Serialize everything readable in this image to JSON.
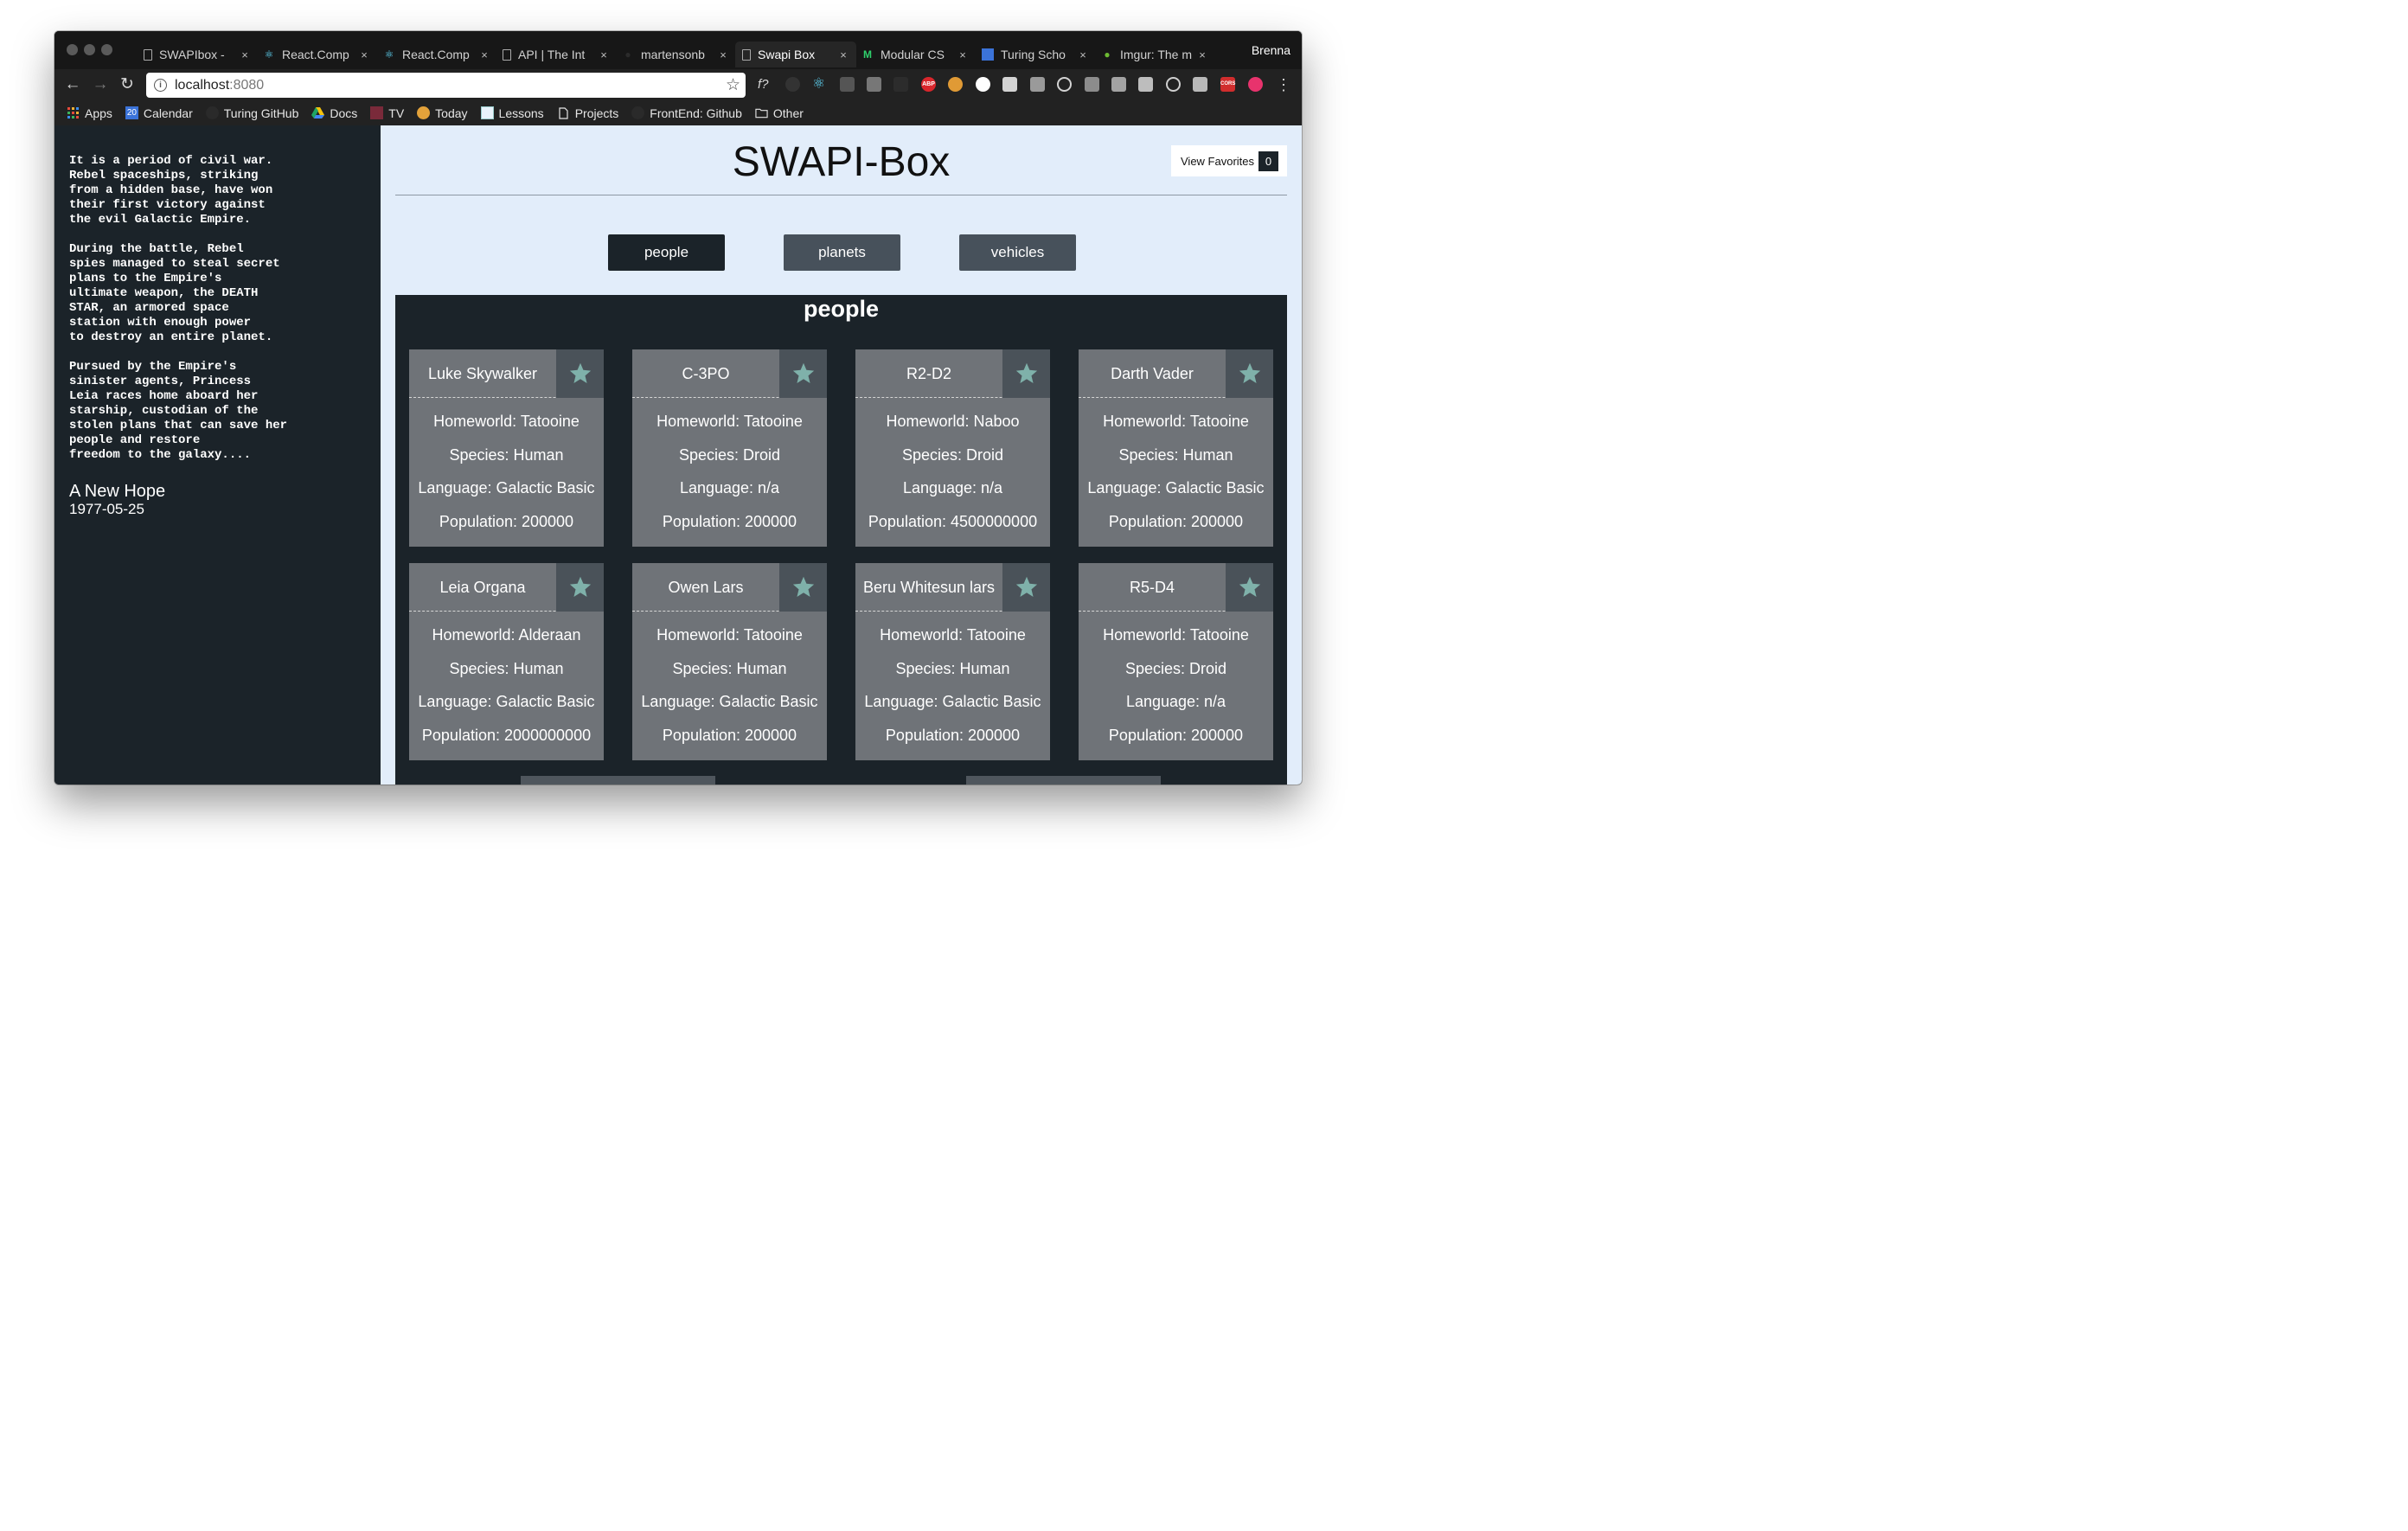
{
  "browser": {
    "tabs": [
      {
        "title": "SWAPIbox - ",
        "icon": "page-icon"
      },
      {
        "title": "React.Comp",
        "icon": "react-icon"
      },
      {
        "title": "React.Comp",
        "icon": "react-icon"
      },
      {
        "title": "API | The Int",
        "icon": "page-icon"
      },
      {
        "title": "martensonb",
        "icon": "github-icon"
      },
      {
        "title": "Swapi Box",
        "icon": "page-icon",
        "active": true
      },
      {
        "title": "Modular CS",
        "icon": "m-icon"
      },
      {
        "title": "Turing Scho",
        "icon": "calendar-icon"
      },
      {
        "title": "Imgur: The m",
        "icon": "green-dot-icon"
      }
    ],
    "close_glyph": "×",
    "profile_name": "Brenna",
    "url_host": "localhost",
    "url_port": ":8080",
    "info_glyph": "i",
    "calendar_day": "20",
    "bookmarks": {
      "apps": "Apps",
      "calendar": "Calendar",
      "turing_github": "Turing GitHub",
      "docs": "Docs",
      "tv": "TV",
      "today": "Today",
      "lessons": "Lessons",
      "projects": "Projects",
      "frontend_github": "FrontEnd: Github",
      "other": "Other"
    },
    "extensions": {
      "f_label": "f?",
      "abp_label": "ABP",
      "cors_label": "CORS"
    }
  },
  "crawl": {
    "text": "It is a period of civil war.\nRebel spaceships, striking\nfrom a hidden base, have won\ntheir first victory against\nthe evil Galactic Empire.\n\nDuring the battle, Rebel\nspies managed to steal secret\nplans to the Empire's\nultimate weapon, the DEATH\nSTAR, an armored space\nstation with enough power\nto destroy an entire planet.\n\nPursued by the Empire's\nsinister agents, Princess\nLeia races home aboard her\nstarship, custodian of the\nstolen plans that can save her\npeople and restore\nfreedom to the galaxy....",
    "film_title": "A New Hope",
    "release_date": "1977-05-25"
  },
  "app": {
    "title": "SWAPI-Box",
    "favorites_label": "View Favorites",
    "favorites_count": "0",
    "categories": [
      "people",
      "planets",
      "vehicles"
    ],
    "active_category": "people",
    "panel_title": "people"
  },
  "people": [
    {
      "name": "Luke Skywalker",
      "homeworld": "Homeworld: Tatooine",
      "species": "Species: Human",
      "language": "Language: Galactic Basic",
      "population": "Population: 200000"
    },
    {
      "name": "C-3PO",
      "homeworld": "Homeworld: Tatooine",
      "species": "Species: Droid",
      "language": "Language: n/a",
      "population": "Population: 200000"
    },
    {
      "name": "R2-D2",
      "homeworld": "Homeworld: Naboo",
      "species": "Species: Droid",
      "language": "Language: n/a",
      "population": "Population: 4500000000"
    },
    {
      "name": "Darth Vader",
      "homeworld": "Homeworld: Tatooine",
      "species": "Species: Human",
      "language": "Language: Galactic Basic",
      "population": "Population: 200000"
    },
    {
      "name": "Leia Organa",
      "homeworld": "Homeworld: Alderaan",
      "species": "Species: Human",
      "language": "Language: Galactic Basic",
      "population": "Population: 2000000000"
    },
    {
      "name": "Owen Lars",
      "homeworld": "Homeworld: Tatooine",
      "species": "Species: Human",
      "language": "Language: Galactic Basic",
      "population": "Population: 200000"
    },
    {
      "name": "Beru Whitesun lars",
      "homeworld": "Homeworld: Tatooine",
      "species": "Species: Human",
      "language": "Language: Galactic Basic",
      "population": "Population: 200000"
    },
    {
      "name": "R5-D4",
      "homeworld": "Homeworld: Tatooine",
      "species": "Species: Droid",
      "language": "Language: n/a",
      "population": "Population: 200000"
    }
  ],
  "colors": {
    "sidebar_bg": "#1b2329",
    "main_bg": "#e2edfa",
    "card_bg": "#6f7378",
    "star_box_bg": "#4a5259",
    "star": "#7fb1aa",
    "active_button": "#1b2329",
    "inactive_button": "#47515b"
  }
}
